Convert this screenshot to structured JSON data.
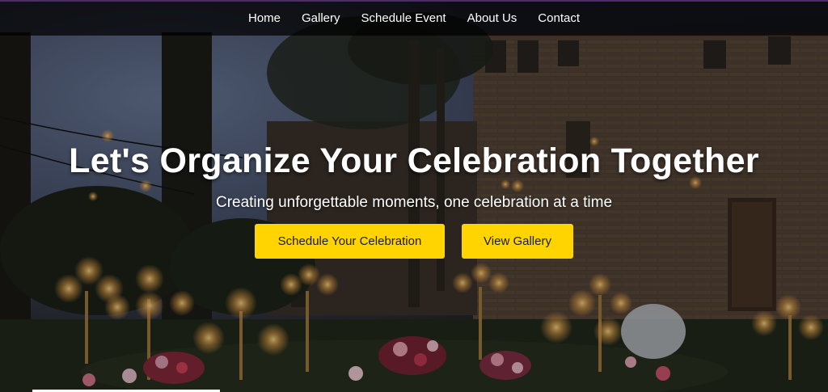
{
  "nav": {
    "items": [
      {
        "label": "Home"
      },
      {
        "label": "Gallery"
      },
      {
        "label": "Schedule Event"
      },
      {
        "label": "About Us"
      },
      {
        "label": "Contact"
      }
    ]
  },
  "hero": {
    "title": "Let's Organize Your Celebration Together",
    "subtitle": "Creating unforgettable moments, one celebration at a time",
    "buttons": {
      "schedule_label": "Schedule Your Celebration",
      "gallery_label": "View Gallery"
    }
  },
  "colors": {
    "accent": "#ffd400",
    "navbar": "#000000",
    "nav_border": "#4b2d6b"
  }
}
